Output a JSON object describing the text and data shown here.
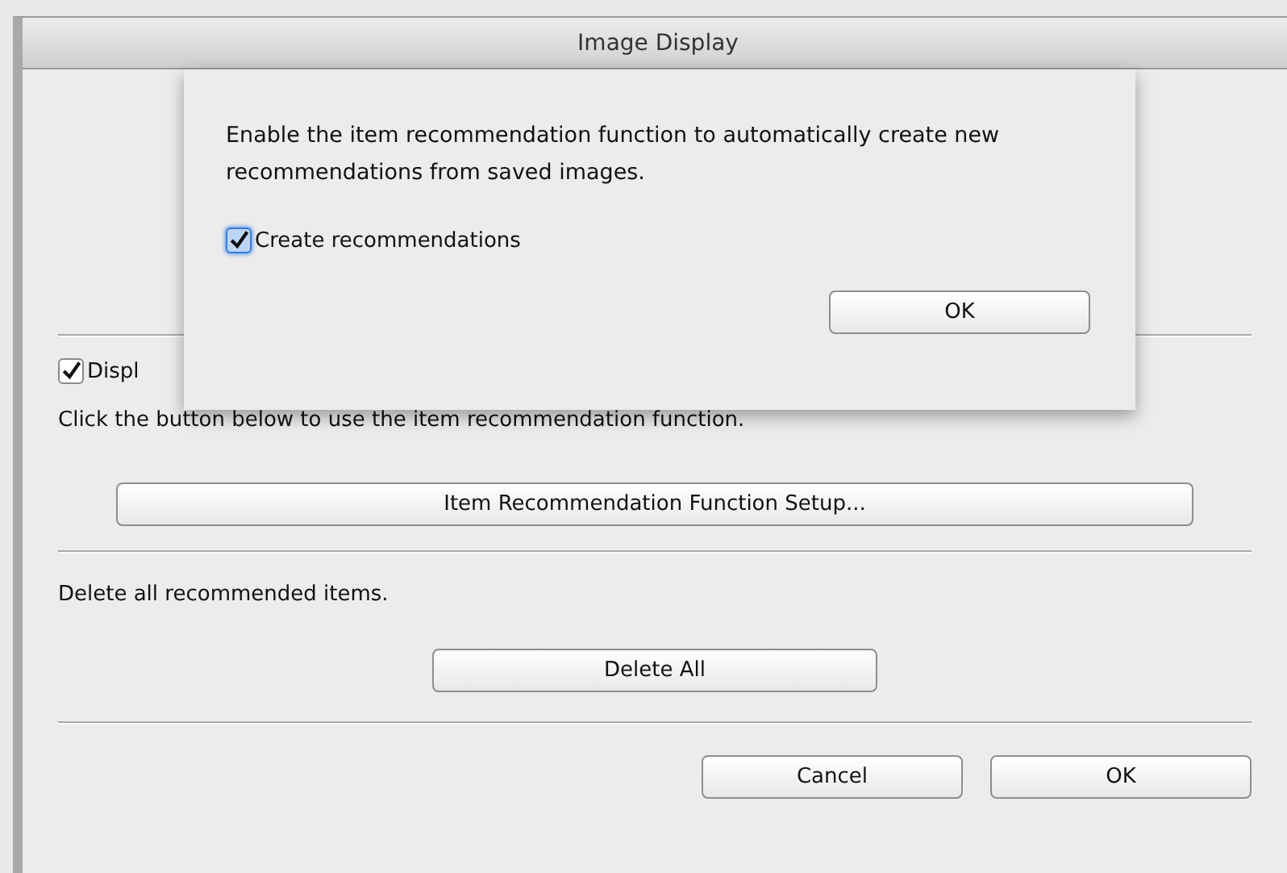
{
  "window": {
    "title": "Image Display"
  },
  "sheet": {
    "message": "Enable the item recommendation function to automatically create new recommendations from saved images.",
    "checkbox": {
      "label": "Create recommendations",
      "checked": true
    },
    "button": "OK"
  },
  "startup_checkbox": {
    "label": "Displ",
    "checked": true
  },
  "setup_text": "Click the button below to use the item recommendation function.",
  "setup_button": "Item Recommendation Function Setup...",
  "delete_text": "Delete all recommended items.",
  "delete_button": "Delete All",
  "buttons": [
    "Cancel",
    "OK"
  ]
}
